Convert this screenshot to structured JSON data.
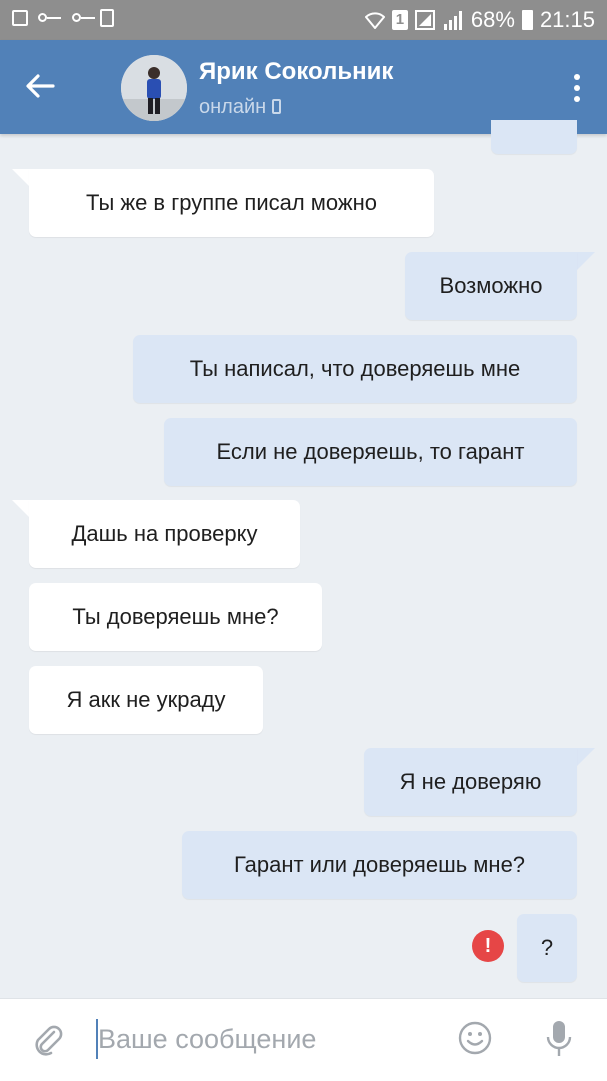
{
  "status_bar": {
    "battery": "68%",
    "time": "21:15",
    "sim": "1"
  },
  "header": {
    "contact_name": "Ярик Сокольник",
    "status": "онлайн"
  },
  "messages": [
    {
      "side": "out",
      "text": ""
    },
    {
      "side": "in",
      "text": "Ты же в группе писал можно"
    },
    {
      "side": "out",
      "text": "Возможно"
    },
    {
      "side": "out",
      "text": "Ты написал, что доверяешь мне"
    },
    {
      "side": "out",
      "text": "Если не доверяешь, то гарант"
    },
    {
      "side": "in",
      "text": "Дашь на проверку"
    },
    {
      "side": "in",
      "text": "Ты доверяешь мне?"
    },
    {
      "side": "in",
      "text": "Я акк не украду"
    },
    {
      "side": "out",
      "text": "Я не доверяю"
    },
    {
      "side": "out",
      "text": "Гарант или доверяешь мне?"
    },
    {
      "side": "out",
      "text": "?",
      "failed": true
    }
  ],
  "error_icon_glyph": "!",
  "composer": {
    "placeholder": "Ваше сообщение"
  },
  "colors": {
    "header": "#5181b8",
    "chat_bg": "#ebeff3",
    "bubble_out": "#dbe6f5",
    "bubble_in": "#ffffff",
    "error": "#e64646"
  }
}
